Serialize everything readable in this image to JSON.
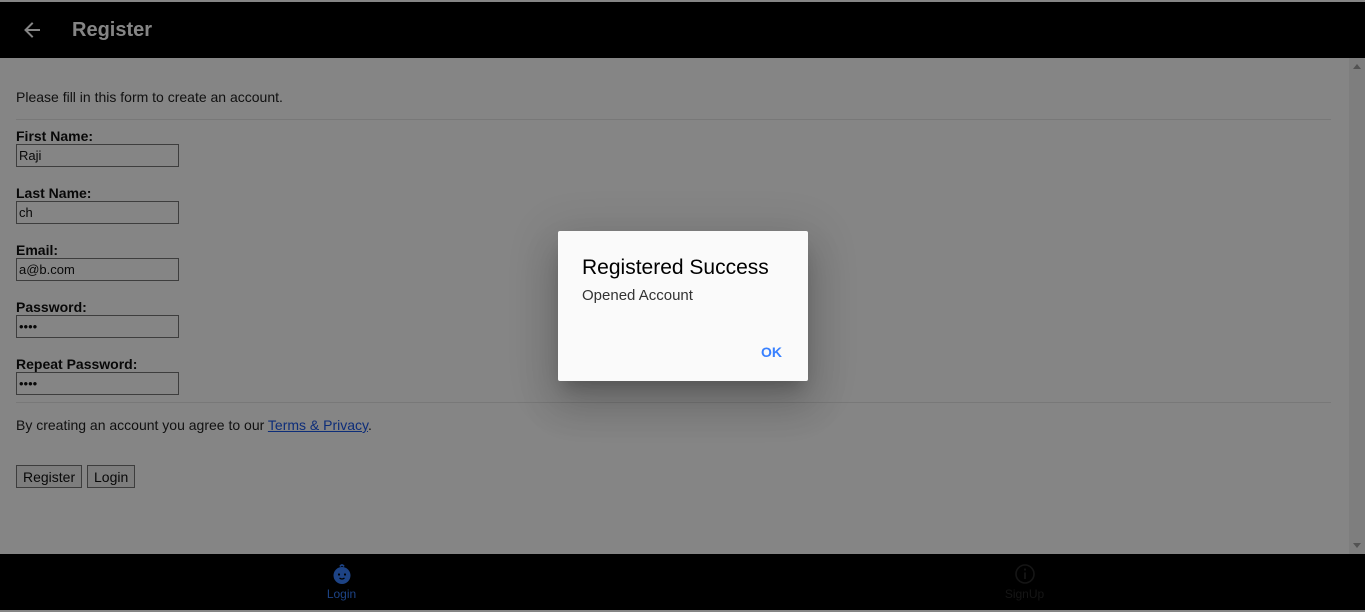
{
  "header": {
    "title": "Register",
    "back_icon": "arrow-left-icon"
  },
  "form": {
    "intro": "Please fill in this form to create an account.",
    "fields": [
      {
        "label": "First Name:",
        "value": "Raji"
      },
      {
        "label": "Last Name:",
        "value": "ch"
      },
      {
        "label": "Email:",
        "value": "a@b.com"
      },
      {
        "label": "Password:",
        "value": "••••"
      },
      {
        "label": "Repeat Password:",
        "value": "••••"
      }
    ],
    "agree_prefix": "By creating an account you agree to our ",
    "agree_link": "Terms & Privacy",
    "agree_suffix": ".",
    "register_label": "Register",
    "login_label": "Login"
  },
  "bottom_nav": {
    "items": [
      {
        "label": "Login",
        "icon": "baby-face-icon",
        "color": "#3880ff",
        "active": true
      },
      {
        "label": "SignUp",
        "icon": "info-circle-icon",
        "color": "#2a2a2a",
        "active": false
      }
    ]
  },
  "dialog": {
    "title": "Registered Success",
    "message": "Opened Account",
    "ok_label": "OK",
    "accent": "#3880ff"
  }
}
